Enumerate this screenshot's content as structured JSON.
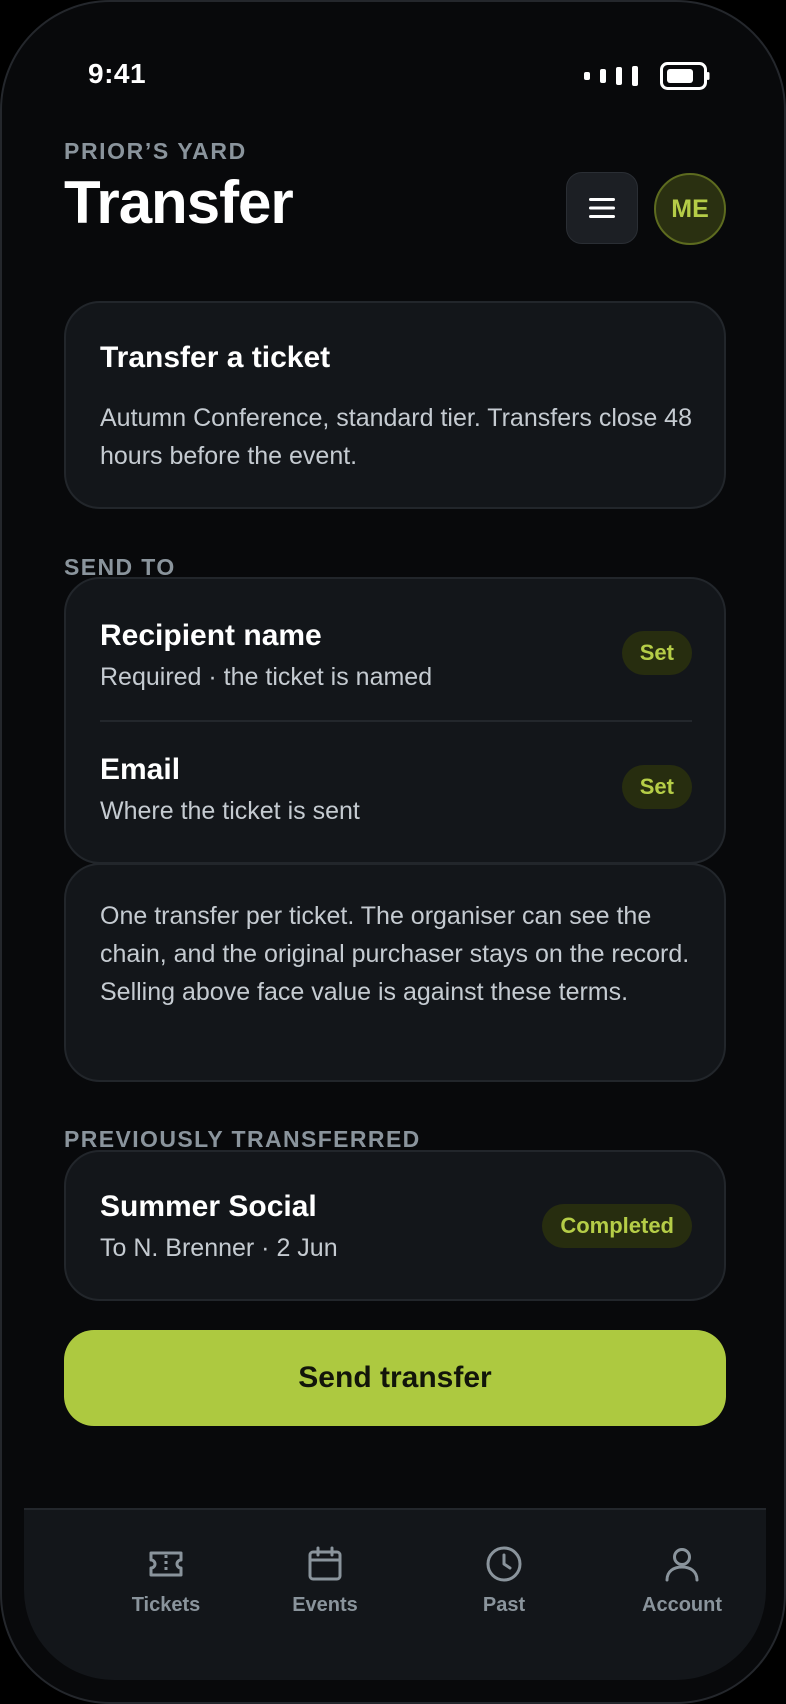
{
  "status_bar": {
    "time": "9:41"
  },
  "header": {
    "eyebrow": "PRIOR’S YARD",
    "title": "Transfer",
    "avatar_initials": "ME"
  },
  "intro": {
    "title": "Transfer a ticket",
    "text": "Autumn Conference, standard tier. Transfers close 48 hours before the event."
  },
  "send_to": {
    "label": "SEND TO",
    "rows": [
      {
        "title": "Recipient name",
        "subtitle": "Required · the ticket is named",
        "action": "Set"
      },
      {
        "title": "Email",
        "subtitle": "Where the ticket is sent",
        "action": "Set"
      }
    ]
  },
  "terms": {
    "text": "One transfer per ticket. The organiser can see the chain, and the original purchaser stays on the record. Selling above face value is against these terms."
  },
  "previous": {
    "label": "PREVIOUSLY TRANSFERRED",
    "items": [
      {
        "title": "Summer Social",
        "subtitle": "To N. Brenner · 2 Jun",
        "status": "Completed"
      }
    ]
  },
  "send_button": {
    "label": "Send transfer"
  },
  "tabbar": {
    "tabs": [
      {
        "label": "Tickets",
        "icon": "ticket-icon"
      },
      {
        "label": "Events",
        "icon": "calendar-icon"
      },
      {
        "label": "Past",
        "icon": "clock-icon"
      },
      {
        "label": "Account",
        "icon": "person-icon"
      }
    ]
  },
  "colors": {
    "accent": "#adc940",
    "accent_text": "#b5cd47",
    "background": "#08090b",
    "card": "#13161a",
    "muted": "#8a949c"
  }
}
